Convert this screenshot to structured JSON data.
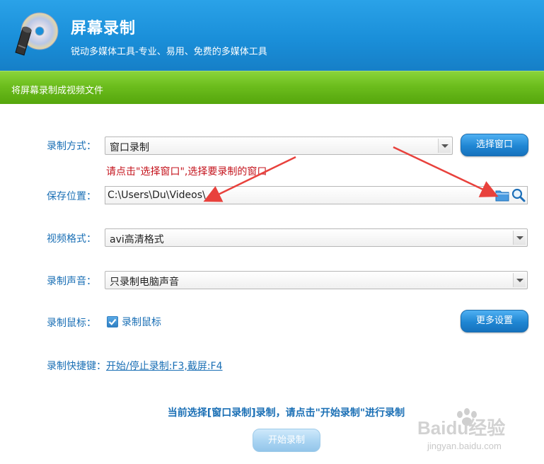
{
  "header": {
    "title": "屏幕录制",
    "subtitle": "锐动多媒体工具-专业、易用、免费的多媒体工具",
    "colors": {
      "header": "#1a8fd9",
      "banner": "#6cbd1d",
      "accent": "#1a6fb5",
      "hint": "#c4131c"
    }
  },
  "banner": {
    "text": "将屏幕录制成视频文件"
  },
  "form": {
    "mode": {
      "label": "录制方式：",
      "value": "窗口录制",
      "button": "选择窗口"
    },
    "hint": "请点击\"选择窗口\",选择要录制的窗口",
    "save": {
      "label": "保存位置：",
      "value": "C:\\Users\\Du\\Videos\\",
      "icons": [
        "folder-icon",
        "search-icon"
      ]
    },
    "format": {
      "label": "视频格式：",
      "value": "avi高清格式"
    },
    "audio": {
      "label": "录制声音：",
      "value": "只录制电脑声音"
    },
    "mouse": {
      "label": "录制鼠标：",
      "checkbox_label": "录制鼠标",
      "checked": true,
      "more_button": "更多设置"
    },
    "shortcut": {
      "label": "录制快捷键：",
      "link": "开始/停止录制:F3,截屏:F4"
    }
  },
  "status": "当前选择[窗口录制]录制，请点击\"开始录制\"进行录制",
  "start_button": "开始录制",
  "watermark": {
    "brand": "Baidu经验",
    "url": "jingyan.baidu.com"
  }
}
